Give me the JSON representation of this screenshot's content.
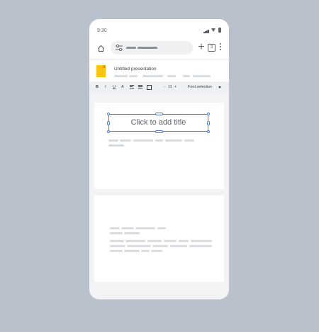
{
  "status_bar": {
    "time": "9:30"
  },
  "toolbar_top": {
    "plus": "+",
    "tab_count": "3"
  },
  "document": {
    "title": "Untitled presentation"
  },
  "format_toolbar": {
    "bold": "B",
    "italic": "I",
    "underline": "U",
    "text_color": "A",
    "font_size_decrease": "-",
    "font_size": "11",
    "font_size_increase": "+",
    "font_selection": "Font selection"
  },
  "slides": [
    {
      "title_placeholder": "Click to add title"
    }
  ],
  "colors": {
    "accent": "#4a7fd8",
    "slides_icon": "#f9c510",
    "background": "#b9c2cc"
  }
}
